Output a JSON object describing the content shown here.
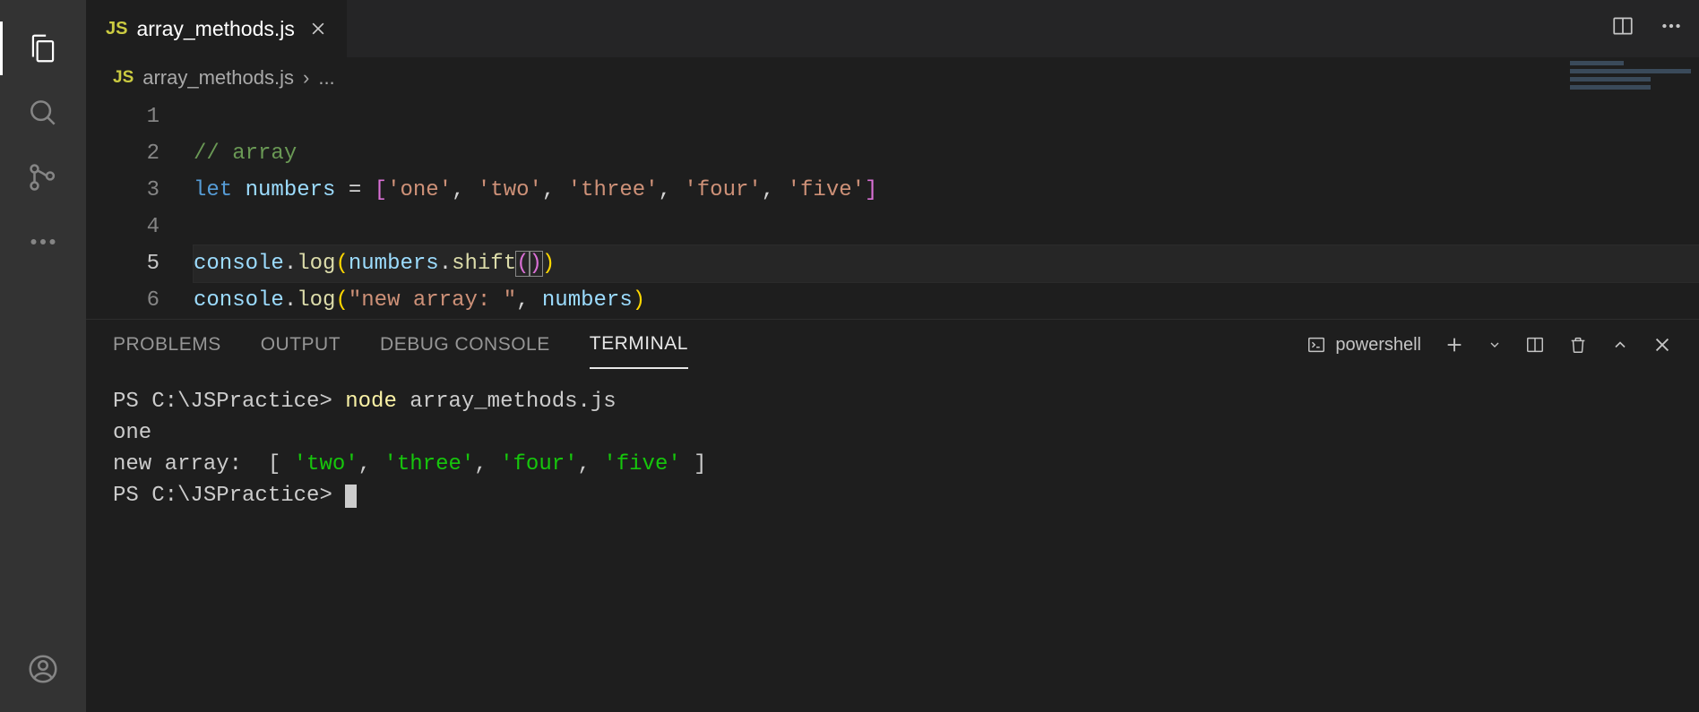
{
  "tab": {
    "filename": "array_methods.js",
    "lang_badge": "JS"
  },
  "breadcrumb": {
    "lang_badge": "JS",
    "filename": "array_methods.js",
    "separator": "›",
    "rest": "..."
  },
  "editor": {
    "line_numbers": [
      "1",
      "2",
      "3",
      "4",
      "5",
      "6"
    ],
    "active_line": "5",
    "lines": {
      "l2_comment": "// array",
      "l3": {
        "let": "let",
        "var": "numbers",
        "eq": " = ",
        "lb": "[",
        "s1": "'one'",
        "c": ", ",
        "s2": "'two'",
        "s3": "'three'",
        "s4": "'four'",
        "s5": "'five'",
        "rb": "]"
      },
      "l5": {
        "obj": "console",
        "dot": ".",
        "log": "log",
        "po": "(",
        "var": "numbers",
        "d2": ".",
        "shift": "shift",
        "pi": "(",
        "pc": ")",
        "pc2": ")"
      },
      "l6": {
        "obj": "console",
        "dot": ".",
        "log": "log",
        "po": "(",
        "str": "\"new array: \"",
        "c": ", ",
        "var": "numbers",
        "pc": ")"
      }
    }
  },
  "panel": {
    "tabs": {
      "problems": "PROBLEMS",
      "output": "OUTPUT",
      "debug": "DEBUG CONSOLE",
      "terminal": "TERMINAL"
    },
    "shell_name": "powershell"
  },
  "terminal": {
    "prompt1": "PS C:\\JSPractice> ",
    "cmd_node": "node",
    "cmd_arg": " array_methods.js",
    "out1": "one",
    "out2_prefix": "new array:  ",
    "out2_arr_open": "[ ",
    "out2_items": [
      "'two'",
      "'three'",
      "'four'",
      "'five'"
    ],
    "out2_sep": ", ",
    "out2_arr_close": " ]",
    "prompt2": "PS C:\\JSPractice> "
  }
}
